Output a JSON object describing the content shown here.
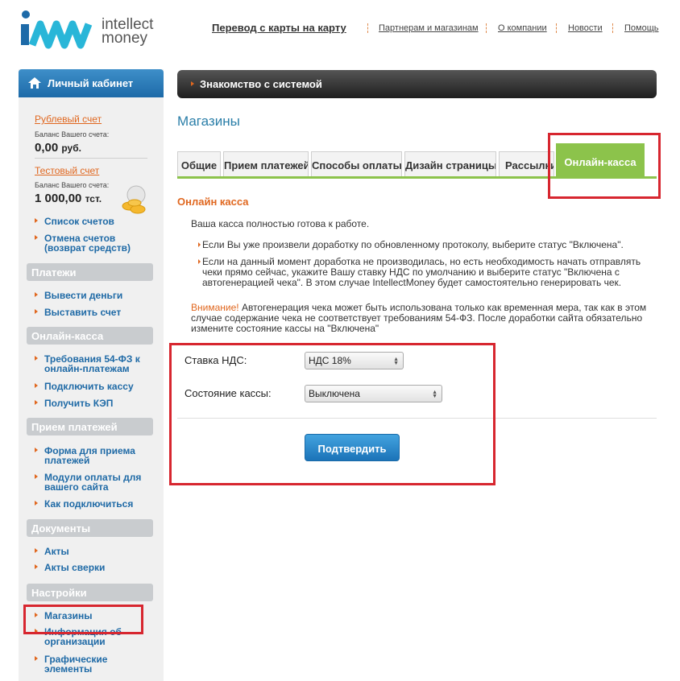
{
  "brand": {
    "line1": "intellect",
    "line2": "money"
  },
  "topnav": {
    "main": "Перевод с карты на карту",
    "links": [
      "Партнерам и магазинам",
      "О компании",
      "Новости",
      "Помощь"
    ]
  },
  "sidebar": {
    "title": "Личный кабинет",
    "accounts": [
      {
        "name": "Рублевый счет",
        "balance_label": "Баланс Вашего счета:",
        "value": "0,00",
        "unit": "руб."
      },
      {
        "name": "Тестовый счет",
        "balance_label": "Баланс Вашего счета:",
        "value": "1 000,00",
        "unit": "тст."
      }
    ],
    "account_links": [
      "Список счетов",
      "Отмена счетов (возврат средств)"
    ],
    "sections": [
      {
        "title": "Платежи",
        "items": [
          "Вывести деньги",
          "Выставить счет"
        ]
      },
      {
        "title": "Онлайн-касса",
        "items": [
          "Требования 54-ФЗ к онлайн-платежам",
          "Подключить кассу",
          "Получить КЭП"
        ]
      },
      {
        "title": "Прием платежей",
        "items": [
          "Форма для приема платежей",
          "Модули оплаты для вашего сайта",
          "Как подключиться"
        ]
      },
      {
        "title": "Документы",
        "items": [
          "Акты",
          "Акты сверки"
        ]
      },
      {
        "title": "Настройки",
        "items": [
          "Магазины",
          "Информация об организации",
          "Графические элементы"
        ]
      }
    ]
  },
  "main": {
    "intro": "Знакомство с системой",
    "title": "Магазины",
    "tabs": [
      "Общие",
      "Прием платежей",
      "Способы оплаты",
      "Дизайн страницы",
      "Рассылки",
      "Онлайн-касса"
    ],
    "active_tab": "Онлайн-касса",
    "section_title": "Онлайн касса",
    "ready_text": "Ваша касса полностью готова к работе.",
    "bullets": [
      "Если Вы уже произвели доработку по обновленному протоколу, выберите статус \"Включена\".",
      "Если на данный момент доработка не производилась, но есть необходимость начать отправлять чеки прямо сейчас, укажите Вашу ставку НДС по умолчанию и выберите статус \"Включена с автогенерацией чека\". В этом случае IntellectMoney будет самостоятельно генерировать чек."
    ],
    "warning_word": "Внимание!",
    "warning_text": " Автогенерация чека может быть использована только как временная мера, так как в этом случае содержание чека не соответствует требованиям 54-ФЗ. После доработки сайта обязательно измените состояние кассы на \"Включена\"",
    "form": {
      "vat_label": "Ставка НДС:",
      "vat_value": "НДС 18%",
      "state_label": "Состояние кассы:",
      "state_value": "Выключена",
      "confirm": "Подтвердить"
    }
  },
  "colors": {
    "accent": "#e0671f",
    "link": "#1f6aa6",
    "tab_active": "#8cc34b",
    "annotation": "#d7262f"
  }
}
